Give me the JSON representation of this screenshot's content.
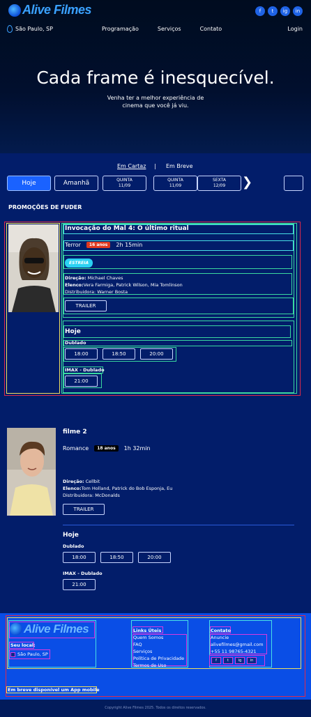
{
  "brand": {
    "name": "Alive Filmes"
  },
  "socials": [
    "f",
    "t",
    "ig",
    "in"
  ],
  "nav": {
    "location": "São Paulo, SP",
    "links": [
      "Programação",
      "Serviços",
      "Contato"
    ],
    "login": "Login"
  },
  "hero": {
    "title": "Cada frame é inesquecível.",
    "subtitle": "Venha ter a melhor experiência de cinema que você já viu."
  },
  "filter": {
    "em_cartaz": "Em Cartaz",
    "separator": "|",
    "em_breve": "Em Breve"
  },
  "days": [
    {
      "label": "Hoje",
      "date": ""
    },
    {
      "label": "Amanhã",
      "date": ""
    },
    {
      "label": "QUINTA",
      "date": "11/09"
    },
    {
      "label": "QUINTA",
      "date": "11/09"
    },
    {
      "label": "SEXTA",
      "date": "12/09"
    }
  ],
  "next_icon": "chevron-right",
  "section_title": "PROMOÇÕES DE FUDER",
  "movies": [
    {
      "title": "Invocação do Mal 4: O último ritual",
      "genre": "Terror",
      "rating": "16 anos",
      "rating_color": "#e0391f",
      "duration": "2h 15min",
      "badge": "ESTREIA",
      "direction_label": "Direção:",
      "direction": "Michael Chaves",
      "cast_label": "Elenco:",
      "cast": "Vera Farmiga, Patrick Wilson, Mia Tomlinson",
      "distributor": "Distribuidora: Warner Bosta",
      "trailer": "TRAILER",
      "day": "Hoje",
      "sessions": [
        {
          "type": "Dublado",
          "times": [
            "18:00",
            "18:50",
            "20:00"
          ]
        },
        {
          "type": "IMAX - Dublado",
          "times": [
            "21:00"
          ]
        }
      ]
    },
    {
      "title": "filme 2",
      "genre": "Romance",
      "rating": "18 anos",
      "rating_color": "#000000",
      "duration": "1h 32min",
      "direction_label": "Direção:",
      "direction": "Cellbit",
      "cast_label": "Elenco:",
      "cast": "Tom Holland, Patrick do Bob Esponja, Eu",
      "distributor": "Distribuidora: McDonalds",
      "trailer": "TRAILER",
      "day": "Hoje",
      "sessions": [
        {
          "type": "Dublado",
          "times": [
            "18:00",
            "18:50",
            "20:00"
          ]
        },
        {
          "type": "IMAX - Dublado",
          "times": [
            "21:00"
          ]
        }
      ]
    }
  ],
  "footer": {
    "local_label": "Seu local:",
    "local_value": "São Paulo, SP",
    "links_title": "Links Úteis",
    "links": [
      "Quem Somos",
      "FAQ",
      "Serviços",
      "Política de Privacidade",
      "Termos de Uso"
    ],
    "contact_title": "Contato",
    "contact": [
      "Anuncie",
      "alivefilmes@gmail.com",
      "+55 11 98765-4321"
    ],
    "app_notice": "Em breve disponível um App mobile",
    "copyright": "Copyright Alive Filmes 2025. Todos os direitos reservados."
  },
  "colors": {
    "accent": "#1a62ff",
    "rating_16": "#e0391f",
    "estreia": "#2ad1f2",
    "footer_bg": "#0a4ee6"
  }
}
